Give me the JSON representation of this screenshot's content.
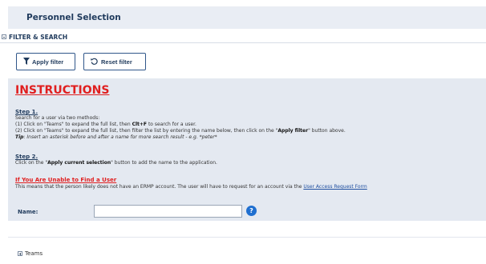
{
  "header": {
    "title": "Personnel Selection"
  },
  "filter": {
    "title": "FILTER & SEARCH",
    "apply_label": "Apply filter",
    "reset_label": "Reset filter",
    "apply_icon": "funnel-icon",
    "reset_icon": "undo-icon"
  },
  "instructions": {
    "title": "INSTRUCTIONS",
    "step1": {
      "heading": "Step 1.",
      "intro": "Search for a user via two methods:",
      "m1_pre": "(1) Click on \"Teams\" to expand the full list, then ",
      "m1_bold": "Clt+F",
      "m1_post": " to search for a user.",
      "m2_pre": "(2) Click on \"Teams\" to expand the full list, then filter the list by entering the name below, then click on the \"",
      "m2_bold": "Apply filter",
      "m2_post": "\" button above.",
      "tip_label": "Tip",
      "tip_text": ": Insert an asterisk before and after a name for more search result - e.g. *peter*"
    },
    "step2": {
      "heading": "Step 2.",
      "pre": "Click on the \"",
      "bold": "Apply current selection",
      "post": "\" button to add the name to the application."
    },
    "unable": {
      "heading": "If You Are Unable to Find a User",
      "text": "This means that the person likely does not have an ERMP account. The user will have to request for an account via the ",
      "link": "User Access Request Form"
    }
  },
  "name_field": {
    "label": "Name:",
    "value": "",
    "help_icon": "question-circle-icon",
    "help_glyph": "?"
  },
  "teams": {
    "label": "Teams",
    "icon": "plus-square-icon"
  },
  "colors": {
    "accent": "#1f3a5c",
    "instructions_red": "#e01f1f",
    "panel_bg": "#e4e9f1",
    "link": "#1f4fa0"
  }
}
